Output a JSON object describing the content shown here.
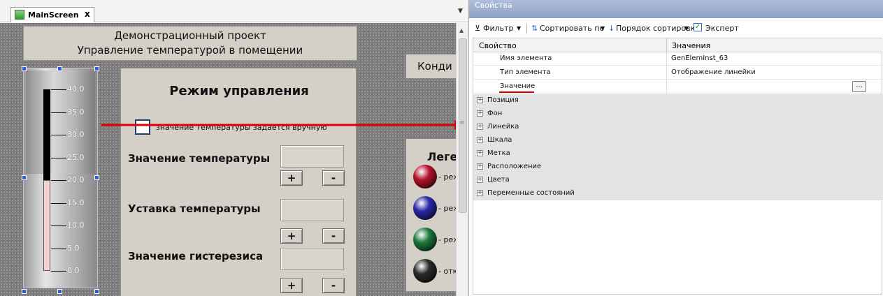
{
  "tab": {
    "label": "MainScreen",
    "close": "x"
  },
  "screen": {
    "title_line1": "Демонстрационный проект",
    "title_line2": "Управление температурой в помещении",
    "thermometer": {
      "value": 20.0,
      "scale_labels": [
        "40.0",
        "35.0",
        "30.0",
        "25.0",
        "20.0",
        "15.0",
        "10.0",
        "5.0",
        "0.0"
      ]
    },
    "control": {
      "title": "Режим управления",
      "checkbox_label": "значение температуры задается вручную",
      "temp_label": "Значение температуры",
      "setpoint_label": "Уставка температуры",
      "hysteresis_label": "Значение гистерезиса",
      "plus": "+",
      "minus": "-"
    },
    "conditioner": {
      "label": "Конди"
    },
    "legend": {
      "title": "Леге",
      "items": [
        {
          "label": "- реж",
          "color": "#b5142b"
        },
        {
          "label": "- реж",
          "color": "#2a2aa8"
        },
        {
          "label": "- реж",
          "color": "#1c7a3a"
        },
        {
          "label": "- отк",
          "color": "#2a2a2a"
        }
      ]
    }
  },
  "properties": {
    "title": "Свойства",
    "toolbar": {
      "filter": "Фильтр",
      "sort_by": "Сортировать по",
      "sort_order": "Порядок сортировки",
      "expert": "Эксперт"
    },
    "columns": {
      "property": "Свойство",
      "value": "Значения"
    },
    "rows": [
      {
        "name": "Имя элемента",
        "value": "GenElemInst_63"
      },
      {
        "name": "Тип элемента",
        "value": "Отображение линейки"
      },
      {
        "name": "Значение",
        "value": ""
      }
    ],
    "ellipsis": "...",
    "groups": [
      "Позиция",
      "Фон",
      "Линейка",
      "Шкала",
      "Метка",
      "Расположение",
      "Цвета",
      "Переменные состояний"
    ]
  },
  "colors": {
    "accent_red": "#e00000",
    "selection_blue": "#2d5fd6"
  }
}
